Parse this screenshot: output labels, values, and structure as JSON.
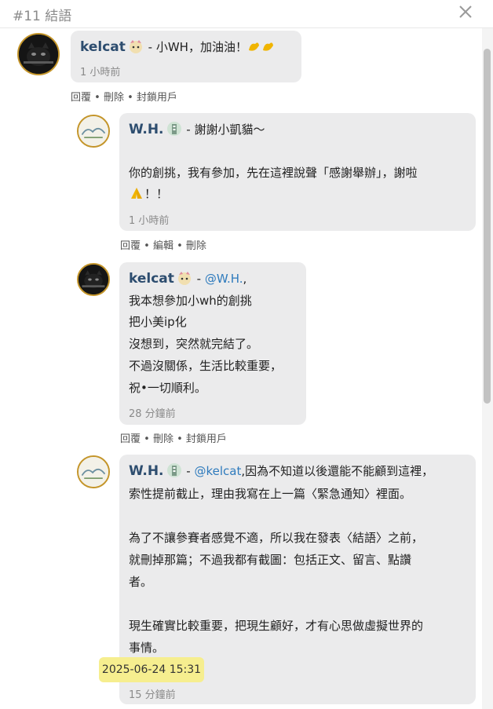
{
  "header": {
    "title": "#11 結語"
  },
  "comments": [
    {
      "username": "kelcat",
      "body_lines": [
        "- 小WH，加油油！"
      ],
      "time": "1 小時前",
      "actions": [
        "回覆",
        "刪除",
        "封鎖用戶"
      ]
    },
    {
      "username": "W.H.",
      "body_lines": [
        "- 謝謝小凱貓～",
        "你的創挑，我有參加，先在這裡說聲「感謝舉辦」，謝啦",
        "！！"
      ],
      "time": "1 小時前",
      "actions": [
        "回覆",
        "編輯",
        "刪除"
      ]
    },
    {
      "username": "kelcat",
      "mention": "@W.H.",
      "after_mention": ",",
      "body_lines": [
        "我本想參加小wh的創挑",
        "把小美ip化",
        "沒想到，突然就完結了。",
        "不過沒關係，生活比較重要，",
        "祝•一切順利。"
      ],
      "time": "28 分鐘前",
      "actions": [
        "回覆",
        "刪除",
        "封鎖用戶"
      ]
    },
    {
      "username": "W.H.",
      "mention": "@kelcat",
      "after_mention": ",因為不知道以後還能不能顧到這裡，",
      "body_lines": [
        "索性提前截止，理由我寫在上一篇〈緊急通知〉裡面。",
        "為了不讓參賽者感覺不適，所以我在發表〈結語〉之前，",
        "就刪掉那篇；不過我都有截圖：包括正文、留言、點讚",
        "者。",
        "現生確實比較重要，把現生顧好，才有心思做虛擬世界的",
        "事情。"
      ],
      "time": "15 分鐘前"
    }
  ],
  "separator": " - ",
  "tooltip": {
    "text": "2025-06-24 15:31"
  },
  "icons": [
    "close-icon",
    "flexed-biceps-emoji",
    "folded-hands-emoji",
    "cat-badge-icon",
    "building-badge-icon"
  ],
  "colors": {
    "username": "#2d4d6f",
    "mention": "#2f7bbd",
    "bubble": "#ebebec",
    "tooltip": "#f6ee8f",
    "avatar_border": "#c4952a"
  }
}
